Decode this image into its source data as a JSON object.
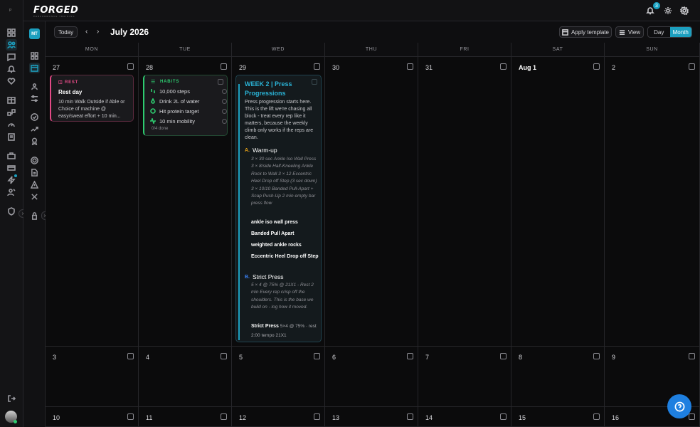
{
  "app": {
    "logo": "FORGED",
    "logo_tagline": "PERFORMANCE TRAINING",
    "notification_count": "3",
    "user_initials": "MT",
    "rail_label": "P"
  },
  "toolbar": {
    "today": "Today",
    "title": "July 2026",
    "apply_template": "Apply template",
    "view": "View",
    "day": "Day",
    "month": "Month"
  },
  "weekdays": [
    "MON",
    "TUE",
    "WED",
    "THU",
    "FRI",
    "SAT",
    "SUN"
  ],
  "week1": [
    "27",
    "28",
    "29",
    "30",
    "31",
    "Aug 1",
    "2"
  ],
  "week2": [
    "3",
    "4",
    "5",
    "6",
    "7",
    "8",
    "9"
  ],
  "week3": [
    "10",
    "11",
    "12",
    "13",
    "14",
    "15",
    "16"
  ],
  "rest_card": {
    "tag": "REST",
    "title": "Rest day",
    "desc": "10 min Walk Outside if Able or Choice of machine @ easy/sweat effort + 10 min..."
  },
  "habits_card": {
    "tag": "HABITS",
    "items": [
      "10,000 steps",
      "Drink 2L of water",
      "Hit protein target",
      "10 min mobility"
    ],
    "done": "0/4 done"
  },
  "week_card": {
    "title": "WEEK 2 | Press Progressions",
    "desc": "Press progression starts here. This is the lift we're chasing all block - treat every rep like it matters, because the weekly climb only works if the reps are clean.",
    "sectionA": {
      "letter": "A.",
      "name": "Warm-up",
      "detail": "3 × 30 sec Ankle Iso Wall Press 3 × 8/side Half-Kneeling Ankle Rock to Wall 3 × 12 Eccentric Heel Drop off Step (3 sec down) 3 × 10/10 Banded Pull-Apart + Scap Push-Up 2 min empty bar press flow",
      "exercises": [
        "ankle iso wall press",
        "Banded Pull Apart",
        "weighted ankle rocks",
        "Eccentric Heel Drop off Step"
      ]
    },
    "sectionB": {
      "letter": "B.",
      "name": "Strict Press",
      "detail": "5 × 4 @ 75% @ 21X1 - Rest 2 min Every rep crisp off the shoulders. This is the base we build on - log how it moved.",
      "exercise": "Strict Press",
      "exercise_meta": "5×4 @ 75% · rest 2:00",
      "exercise_tempo": "tempo 21X1"
    }
  },
  "colors": {
    "accent": "#1c9fbf",
    "rest": "#e24a86",
    "habits": "#2ecb6f",
    "sectionA": "#e8a317",
    "sectionB": "#3b82f6"
  }
}
